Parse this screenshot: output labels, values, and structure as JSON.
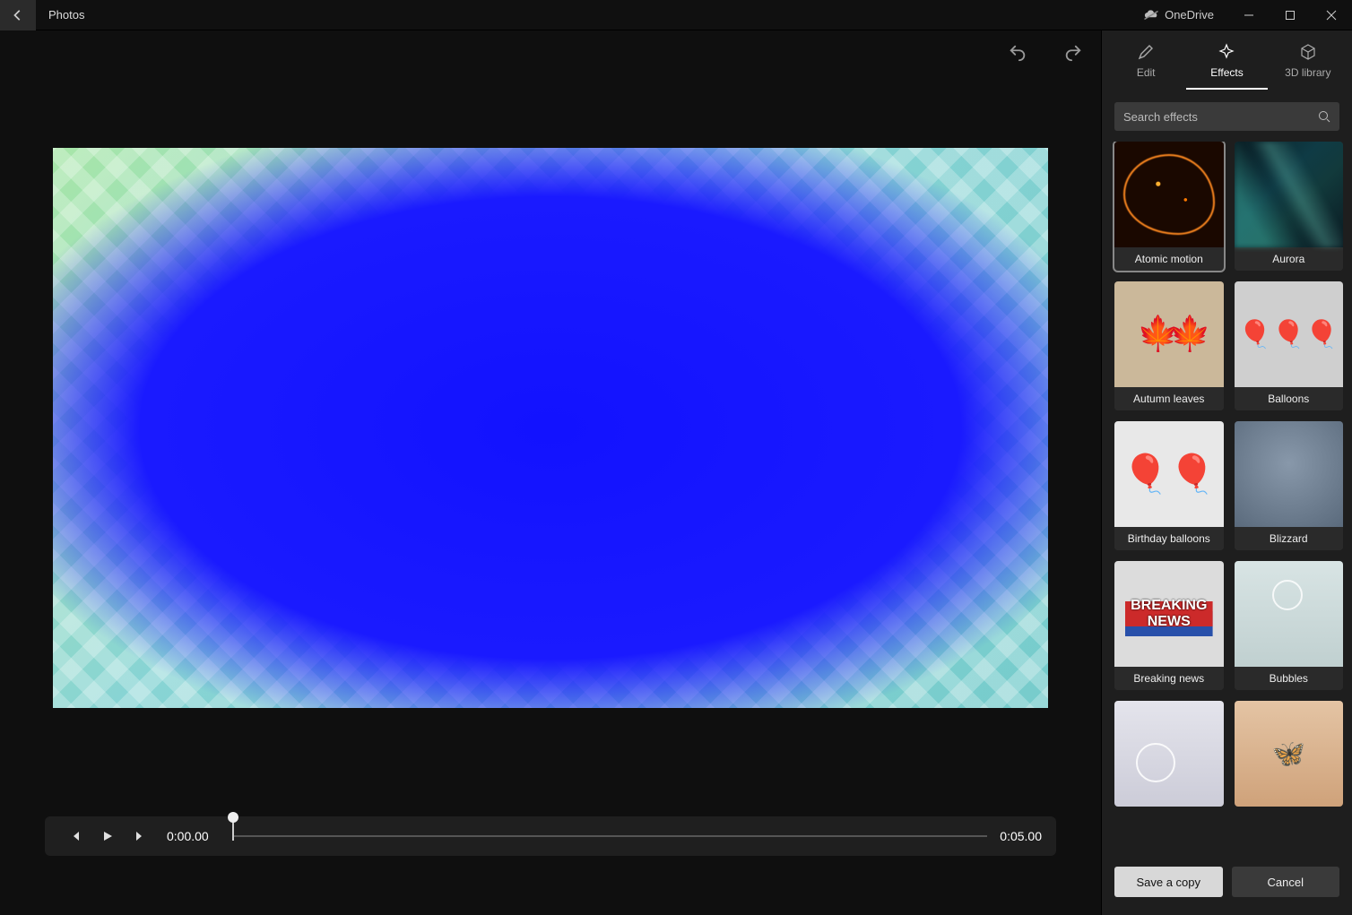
{
  "titlebar": {
    "app_name": "Photos",
    "cloud_label": "OneDrive"
  },
  "sidebar": {
    "tabs": {
      "edit": "Edit",
      "effects": "Effects",
      "library3d": "3D library"
    },
    "active_tab": "effects",
    "search_placeholder": "Search effects",
    "effects": [
      {
        "id": "atomic",
        "label": "Atomic motion",
        "selected": true
      },
      {
        "id": "aurora",
        "label": "Aurora",
        "selected": false
      },
      {
        "id": "leaves",
        "label": "Autumn leaves",
        "selected": false
      },
      {
        "id": "balloons",
        "label": "Balloons",
        "selected": false
      },
      {
        "id": "birthday",
        "label": "Birthday balloons",
        "selected": false
      },
      {
        "id": "blizzard",
        "label": "Blizzard",
        "selected": false
      },
      {
        "id": "news",
        "label": "Breaking news",
        "selected": false
      },
      {
        "id": "bubbles",
        "label": "Bubbles",
        "selected": false
      },
      {
        "id": "bubbles2",
        "label": "",
        "selected": false
      },
      {
        "id": "butterfly",
        "label": "",
        "selected": false
      }
    ],
    "buttons": {
      "save": "Save a copy",
      "cancel": "Cancel"
    }
  },
  "playback": {
    "current_time": "0:00.00",
    "total_time": "0:05.00",
    "playhead_pct": 0
  }
}
